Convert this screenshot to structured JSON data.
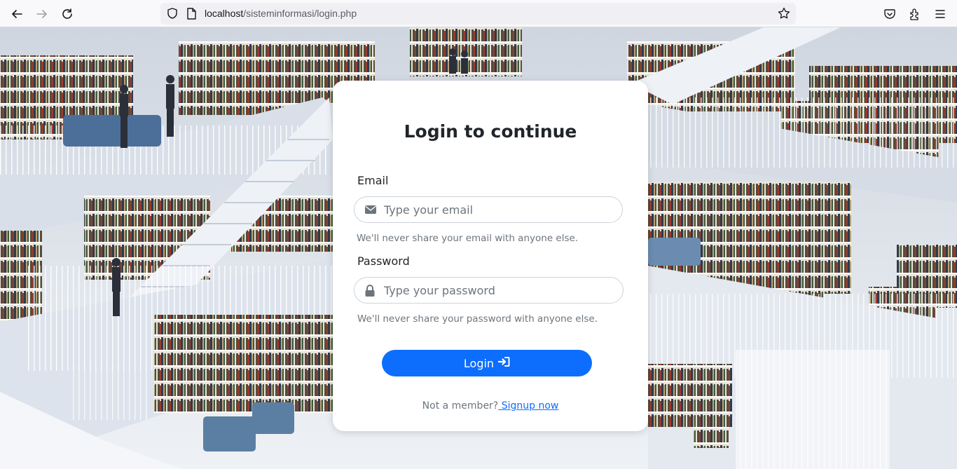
{
  "browser": {
    "url_host": "localhost",
    "url_path": "/sisteminformasi/login.php",
    "icons": [
      "back-icon",
      "forward-icon",
      "reload-icon",
      "shield-icon",
      "page-icon",
      "star-icon",
      "pocket-icon",
      "extensions-icon",
      "menu-icon"
    ]
  },
  "login": {
    "title": "Login to continue",
    "email_label": "Email",
    "email_placeholder": "Type your email",
    "email_hint": "We'll never share your email with anyone else.",
    "password_label": "Password",
    "password_placeholder": "Type your password",
    "password_hint": "We'll never share your password with anyone else.",
    "button_label": "Login",
    "signup_prompt": "Not a member?",
    "signup_link": " Signup now"
  },
  "colors": {
    "primary": "#0d6efd",
    "card_bg": "#ffffff",
    "muted_text": "#6c757d"
  }
}
